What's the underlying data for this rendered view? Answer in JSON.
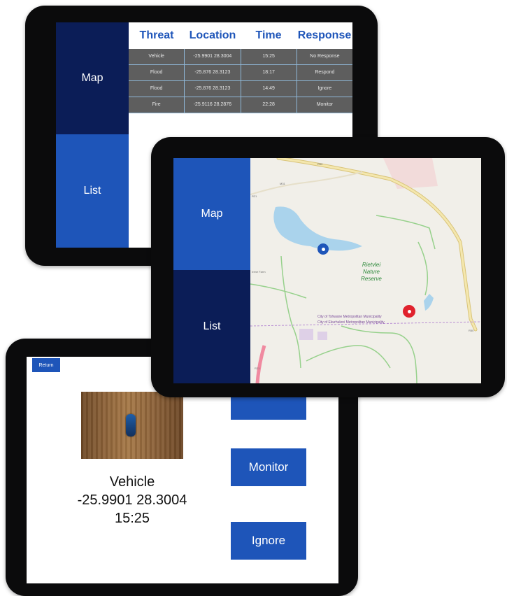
{
  "list_tablet": {
    "sidebar": {
      "map_label": "Map",
      "list_label": "List"
    },
    "table": {
      "headers": [
        "Threat",
        "Location",
        "Time",
        "Response"
      ],
      "rows": [
        [
          "Vehicle",
          "-25.9901 28.3004",
          "15:25",
          "No Response"
        ],
        [
          "Flood",
          "-25.876 28.3123",
          "18:17",
          "Respond"
        ],
        [
          "Flood",
          "-25.876 28.3123",
          "14:49",
          "Ignore"
        ],
        [
          "Fire",
          "-25.9116 28.2876",
          "22:28",
          "Monitor"
        ]
      ]
    }
  },
  "map_tablet": {
    "sidebar": {
      "map_label": "Map",
      "list_label": "List"
    },
    "map": {
      "reserve_label": "Rietvlei Nature Reserve",
      "municipality_labels": [
        "City of Tshwane Metropolitan Municipality",
        "City of Ekurhuleni Metropolitan Municipality"
      ],
      "road_labels": [
        "R50",
        "M31",
        "R21",
        "R50",
        "R21"
      ],
      "place_label": "Irene Farm",
      "markers": [
        {
          "name": "blue-marker",
          "color": "#1e55b9"
        },
        {
          "name": "red-marker",
          "color": "#e0222d"
        }
      ]
    }
  },
  "detail_tablet": {
    "return_label": "Return",
    "threat": "Vehicle",
    "location": "-25.9901 28.3004",
    "time": "15:25",
    "buttons": {
      "monitor": "Monitor",
      "ignore": "Ignore"
    }
  },
  "colors": {
    "dark_navy": "#0b1d57",
    "accent_blue": "#1e55b9",
    "table_row": "#5e5e5e",
    "red_marker": "#e0222d"
  }
}
